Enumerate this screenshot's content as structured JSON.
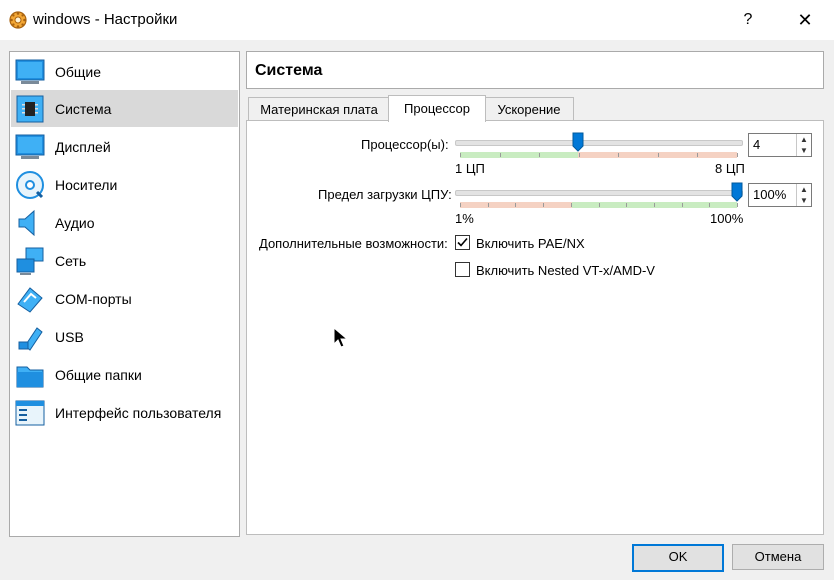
{
  "window": {
    "title": "windows - Настройки",
    "help": "?",
    "close": "✕"
  },
  "sidebar": {
    "selected": 1,
    "items": [
      {
        "label": "Общие",
        "icon": "general-icon"
      },
      {
        "label": "Система",
        "icon": "system-chip-icon"
      },
      {
        "label": "Дисплей",
        "icon": "display-icon"
      },
      {
        "label": "Носители",
        "icon": "storage-disc-icon"
      },
      {
        "label": "Аудио",
        "icon": "audio-speaker-icon"
      },
      {
        "label": "Сеть",
        "icon": "network-icon"
      },
      {
        "label": "COM-порты",
        "icon": "serial-port-icon"
      },
      {
        "label": "USB",
        "icon": "usb-icon"
      },
      {
        "label": "Общие папки",
        "icon": "shared-folder-icon"
      },
      {
        "label": "Интерфейс пользователя",
        "icon": "user-interface-icon"
      }
    ]
  },
  "header": {
    "title": "Система"
  },
  "tabs": [
    {
      "label": "Материнская плата"
    },
    {
      "label": "Процессор"
    },
    {
      "label": "Ускорение"
    }
  ],
  "active_tab": 1,
  "processor": {
    "label": "Процессор(ы):",
    "value": "4",
    "min_label": "1 ЦП",
    "max_label": "8 ЦП",
    "min": 1,
    "max": 8,
    "current": 4
  },
  "cpu_limit": {
    "label": "Предел загрузки ЦПУ:",
    "value": "100%",
    "min_label": "1%",
    "max_label": "100%",
    "min": 1,
    "max": 100,
    "current": 100
  },
  "extended": {
    "label": "Дополнительные возможности:",
    "options": [
      {
        "label": "Включить PAE/NX",
        "checked": true
      },
      {
        "label": "Включить Nested VT-x/AMD-V",
        "checked": false
      }
    ]
  },
  "buttons": {
    "ok": "OK",
    "cancel": "Отмена"
  },
  "colors": {
    "accent": "#0078d7",
    "band_good": "#c9ecc1",
    "band_warn": "#f5d2c3",
    "selected_bg": "#d9d9d9"
  }
}
